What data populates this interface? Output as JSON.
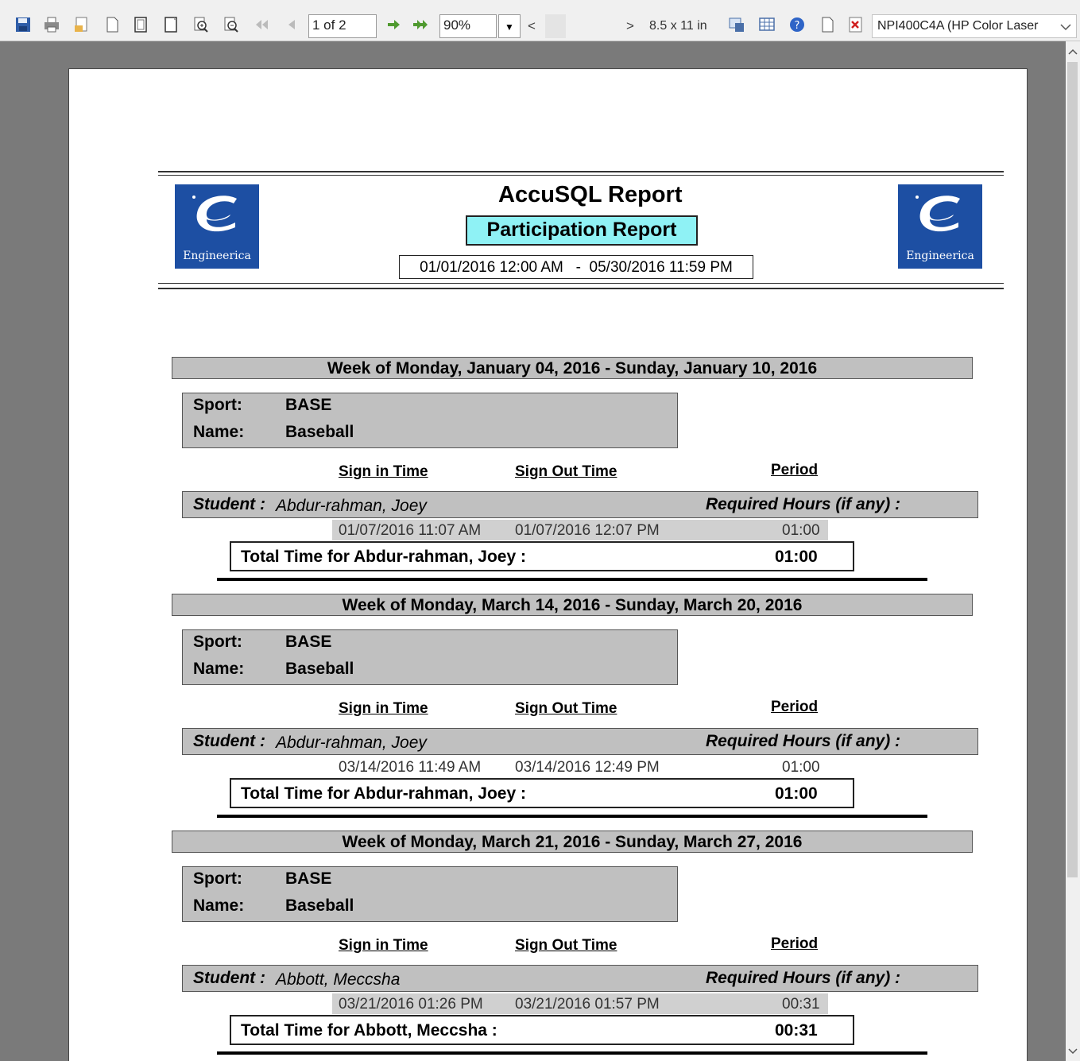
{
  "toolbar": {
    "page_value": "1 of 2",
    "zoom_value": "90%",
    "paper_size": "8.5 x 11 in",
    "printer": "NPI400C4A (HP Color Laser"
  },
  "report": {
    "title": "AccuSQL Report",
    "subtitle": "Participation Report",
    "date_range": "01/01/2016 12:00 AM   -  05/30/2016 11:59 PM",
    "logo_text": "Engineerica",
    "labels": {
      "sport": "Sport:",
      "name": "Name:",
      "sign_in": "Sign in Time",
      "sign_out": "Sign Out Time",
      "period": "Period",
      "student": "Student :",
      "required": "Required Hours (if any) :"
    },
    "weeks": [
      {
        "header": "Week of Monday, January 04, 2016 - Sunday, January 10, 2016",
        "sport": "BASE",
        "name": "Baseball",
        "student": "Abdur-rahman, Joey",
        "sign_in": "01/07/2016 11:07 AM",
        "sign_out": "01/07/2016 12:07 PM",
        "period": "01:00",
        "total_label": "Total Time for Abdur-rahman, Joey :",
        "total_value": "01:00"
      },
      {
        "header": "Week of Monday, March 14, 2016 - Sunday, March 20, 2016",
        "sport": "BASE",
        "name": "Baseball",
        "student": "Abdur-rahman, Joey",
        "sign_in": "03/14/2016 11:49 AM",
        "sign_out": "03/14/2016 12:49 PM",
        "period": "01:00",
        "total_label": "Total Time for Abdur-rahman, Joey :",
        "total_value": "01:00"
      },
      {
        "header": "Week of Monday, March 21, 2016 - Sunday, March 27, 2016",
        "sport": "BASE",
        "name": "Baseball",
        "student": "Abbott, Meccsha",
        "sign_in": "03/21/2016 01:26 PM",
        "sign_out": "03/21/2016 01:57 PM",
        "period": "00:31",
        "total_label": "Total Time for Abbott, Meccsha :",
        "total_value": "00:31"
      }
    ]
  }
}
